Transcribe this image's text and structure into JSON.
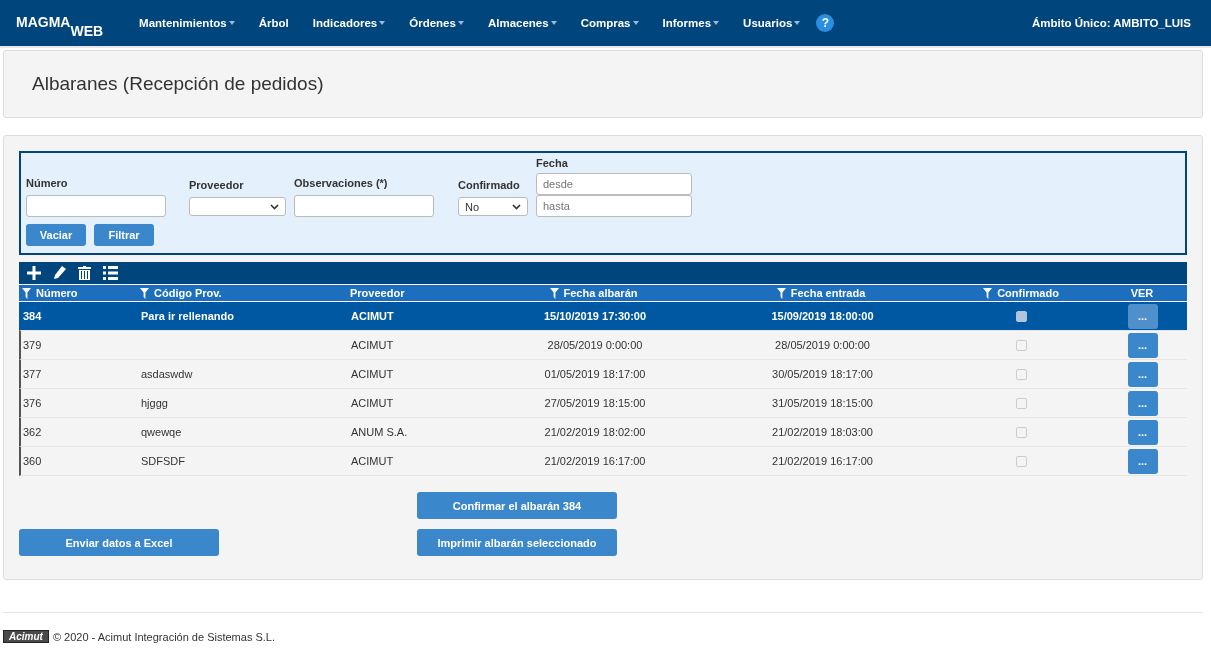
{
  "navbar": {
    "logo_main": "MAGMA",
    "logo_sub": "WEB",
    "menu": [
      {
        "label": "Mantenimientos",
        "has_dropdown": true
      },
      {
        "label": "Árbol",
        "has_dropdown": false
      },
      {
        "label": "Indicadores",
        "has_dropdown": true
      },
      {
        "label": "Órdenes",
        "has_dropdown": true
      },
      {
        "label": "Almacenes",
        "has_dropdown": true
      },
      {
        "label": "Compras",
        "has_dropdown": true
      },
      {
        "label": "Informes",
        "has_dropdown": true
      },
      {
        "label": "Usuarios",
        "has_dropdown": true
      }
    ],
    "help": "?",
    "scope": "Ámbito Único: AMBITO_LUIS"
  },
  "page_title": "Albaranes (Recepción de pedidos)",
  "filters": {
    "numero": {
      "label": "Número"
    },
    "proveedor": {
      "label": "Proveedor"
    },
    "observaciones": {
      "label": "Observaciones (*)"
    },
    "confirmado": {
      "label": "Confirmado",
      "value": "No"
    },
    "fecha": {
      "label": "Fecha",
      "from_placeholder": "desde",
      "to_placeholder": "hasta"
    },
    "buttons": [
      "Vaciar",
      "Filtrar"
    ]
  },
  "table": {
    "columns": [
      {
        "label": "Número",
        "filterable": true
      },
      {
        "label": "Código Prov.",
        "filterable": true
      },
      {
        "label": "Proveedor",
        "filterable": false
      },
      {
        "label": "Fecha albarán",
        "filterable": true
      },
      {
        "label": "Fecha entrada",
        "filterable": true
      },
      {
        "label": "Confirmado",
        "filterable": true
      },
      {
        "label": "VER",
        "filterable": false
      }
    ],
    "rows": [
      {
        "numero": "384",
        "codigo": "Para ir rellenando",
        "proveedor": "ACIMUT",
        "fecha_albaran": "15/10/2019 17:30:00",
        "fecha_entrada": "15/09/2019 18:00:00",
        "confirmado": false,
        "ver": "...",
        "selected": true
      },
      {
        "numero": "379",
        "proveedor": "ACIMUT",
        "fecha_albaran": "28/05/2019 0:00:00",
        "fecha_entrada": "28/05/2019 0:00:00",
        "confirmado": false,
        "ver": "...",
        "selected": false
      },
      {
        "numero": "377",
        "codigo": "asdaswdw",
        "proveedor": "ACIMUT",
        "fecha_albaran": "01/05/2019 18:17:00",
        "fecha_entrada": "30/05/2019 18:17:00",
        "confirmado": false,
        "ver": "...",
        "selected": false
      },
      {
        "numero": "376",
        "codigo": "hjggg",
        "proveedor": "ACIMUT",
        "fecha_albaran": "27/05/2019 18:15:00",
        "fecha_entrada": "31/05/2019 18:15:00",
        "confirmado": false,
        "ver": "...",
        "selected": false
      },
      {
        "numero": "362",
        "codigo": "qwewqe",
        "proveedor": "ANUM S.A.",
        "fecha_albaran": "21/02/2019 18:02:00",
        "fecha_entrada": "21/02/2019 18:03:00",
        "confirmado": false,
        "ver": "...",
        "selected": false
      },
      {
        "numero": "360",
        "codigo": "SDFSDF",
        "proveedor": "ACIMUT",
        "fecha_albaran": "21/02/2019 16:17:00",
        "fecha_entrada": "21/02/2019 16:17:00",
        "confirmado": false,
        "ver": "...",
        "selected": false
      }
    ]
  },
  "actions": {
    "excel": "Enviar datos a Excel",
    "confirm": "Confirmar el albarán 384",
    "print": "Imprimir albarán seleccionado"
  },
  "footer": {
    "logo": "Acimut",
    "text": "© 2020 - Acimut Integración de Sistemas S.L."
  }
}
